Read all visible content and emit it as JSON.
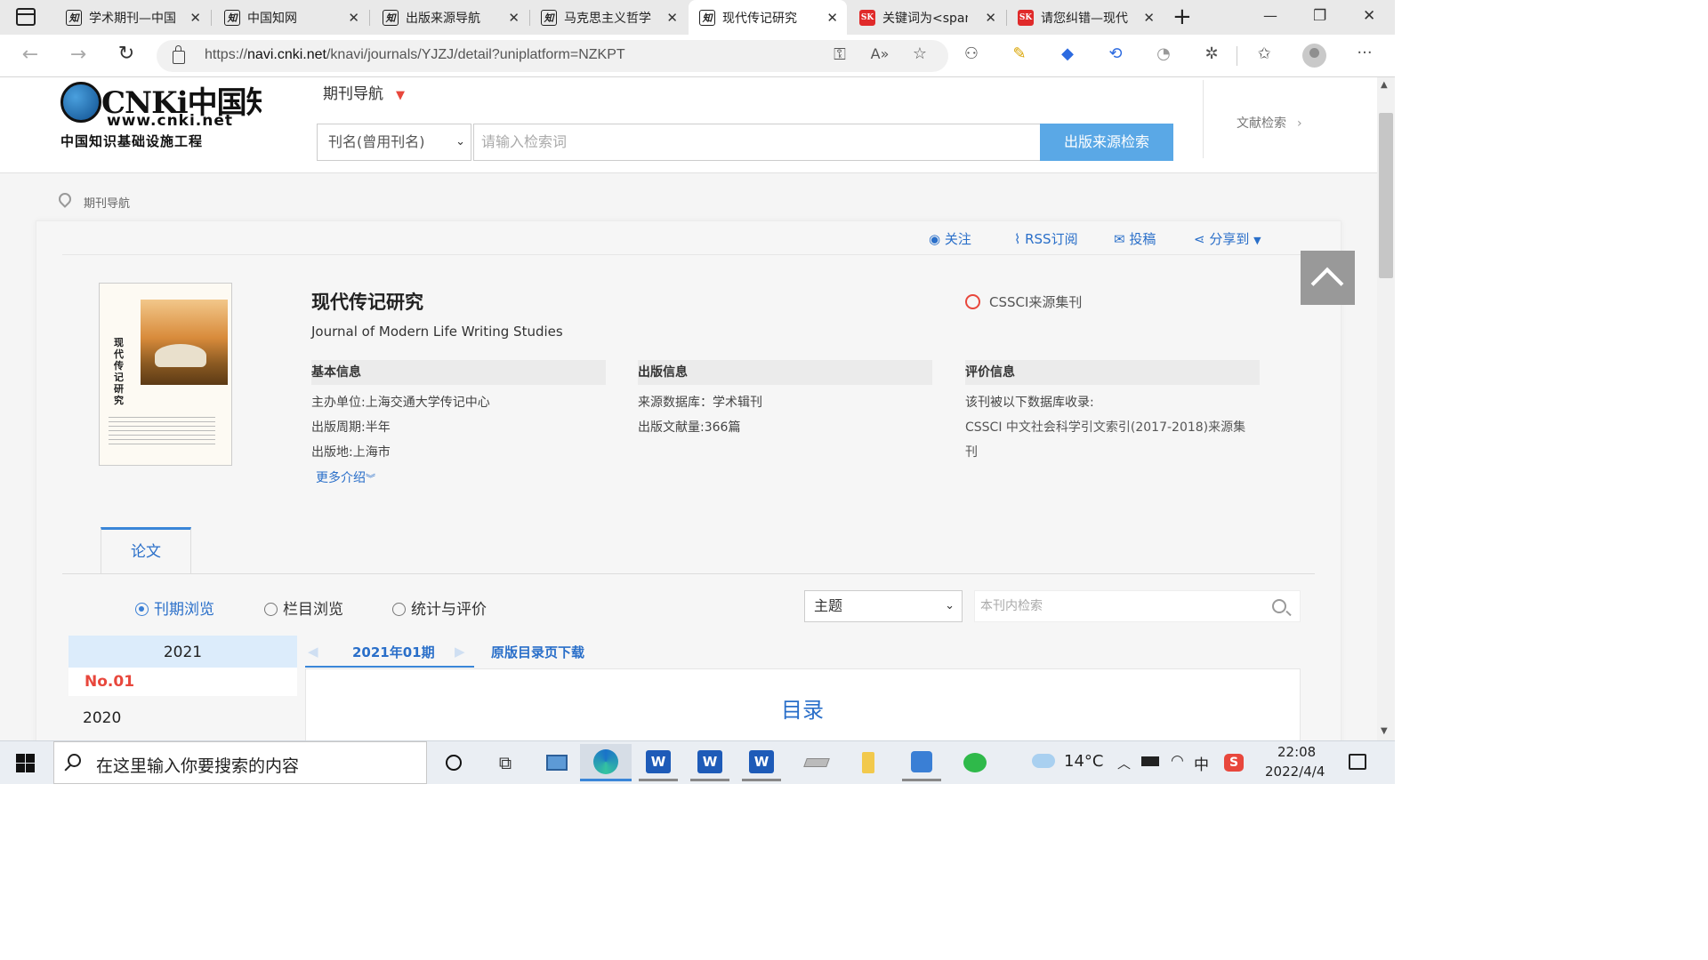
{
  "browser": {
    "tabs": [
      {
        "title": "学术期刊—中国",
        "icon": "知"
      },
      {
        "title": "中国知网",
        "icon": "知"
      },
      {
        "title": "出版来源导航",
        "icon": "知"
      },
      {
        "title": "马克思主义哲学",
        "icon": "知"
      },
      {
        "title": "现代传记研究",
        "icon": "知"
      },
      {
        "title": "关键词为<span",
        "icon": "SK"
      },
      {
        "title": "请您纠错—现代",
        "icon": "SK"
      }
    ],
    "url_prefix": "https://",
    "url_domain": "navi.cnki.net",
    "url_path": "/knavi/journals/YJZJ/detail?uniplatform=NZKPT",
    "window_min": "—",
    "window_max": "❐",
    "window_close": "✕"
  },
  "header": {
    "logo_main": "CNKi中国知网",
    "logo_url": "www.cnki.net",
    "logo_sub": "中国知识基础设施工程",
    "nav_title": "期刊导航",
    "search_select": "刊名(曾用刊名)",
    "search_placeholder": "请输入检索词",
    "search_button": "出版来源检索",
    "right_link": "文献检索"
  },
  "breadcrumb": "期刊导航",
  "actions": {
    "follow": "关注",
    "rss": "RSS订阅",
    "submit": "投稿",
    "share": "分享到"
  },
  "journal": {
    "title_cn": "现代传记研究",
    "title_en": "Journal of Modern Life Writing Studies",
    "badge": "CSSCI来源集刊",
    "basic_heading": "基本信息",
    "sponsor_label": "主办单位:",
    "sponsor_value": "上海交通大学传记中心",
    "cycle_label": "出版周期:",
    "cycle_value": "半年",
    "place_label": "出版地:",
    "place_value": "上海市",
    "more": "更多介绍",
    "pub_heading": "出版信息",
    "db_label": "来源数据库：",
    "db_value": "学术辑刊",
    "count_label": "出版文献量:",
    "count_value": "366篇",
    "eval_heading": "评价信息",
    "eval_intro": "该刊被以下数据库收录:",
    "eval_line1": "CSSCI 中文社会科学引文索引(2017-2018)来源集",
    "eval_line2": "刊"
  },
  "tabs_section": {
    "tab_label": "论文",
    "radio_issue": "刊期浏览",
    "radio_column": "栏目浏览",
    "radio_stats": "统计与评价",
    "topic_select": "主题",
    "inner_search_placeholder": "本刊内检索"
  },
  "years": {
    "year_2021": "2021",
    "no01": "No.01",
    "year_2020": "2020"
  },
  "issue": {
    "current": "2021年01期",
    "download": "原版目录页下载",
    "toc_title": "目录"
  },
  "taskbar": {
    "search_placeholder": "在这里输入你要搜索的内容",
    "weather": "14°C",
    "ime": "中",
    "time": "22:08",
    "date": "2022/4/4"
  },
  "colors": {
    "accent_blue": "#5aa8e6",
    "link_blue": "#2a6fc9",
    "red": "#e8473c"
  }
}
